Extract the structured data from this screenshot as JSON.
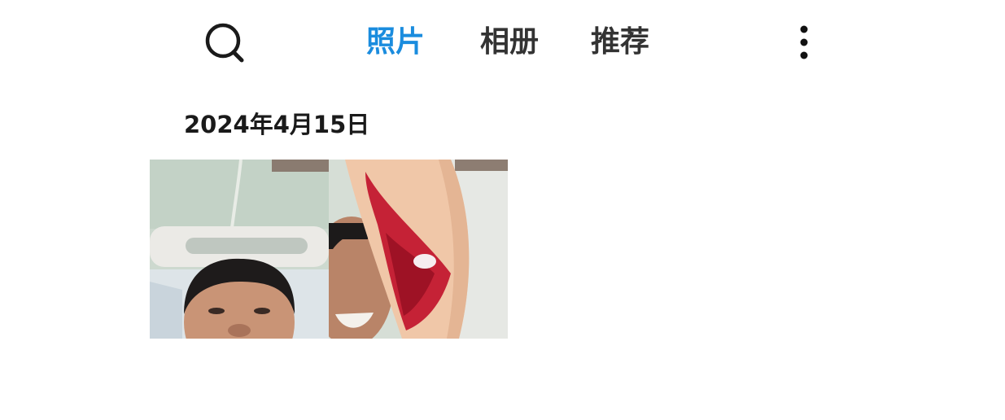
{
  "header": {
    "search_icon": "search-icon",
    "tabs": [
      {
        "label": "照片",
        "active": true
      },
      {
        "label": "相册",
        "active": false
      },
      {
        "label": "推荐",
        "active": false
      }
    ],
    "more_icon": "more-vertical-icon",
    "active_color": "#1a8cde"
  },
  "gallery": {
    "date": "2024年4月15日",
    "photos": [
      {
        "subject": "selfie-in-hospital-bed"
      },
      {
        "subject": "selfie-with-injured-arm"
      }
    ]
  }
}
